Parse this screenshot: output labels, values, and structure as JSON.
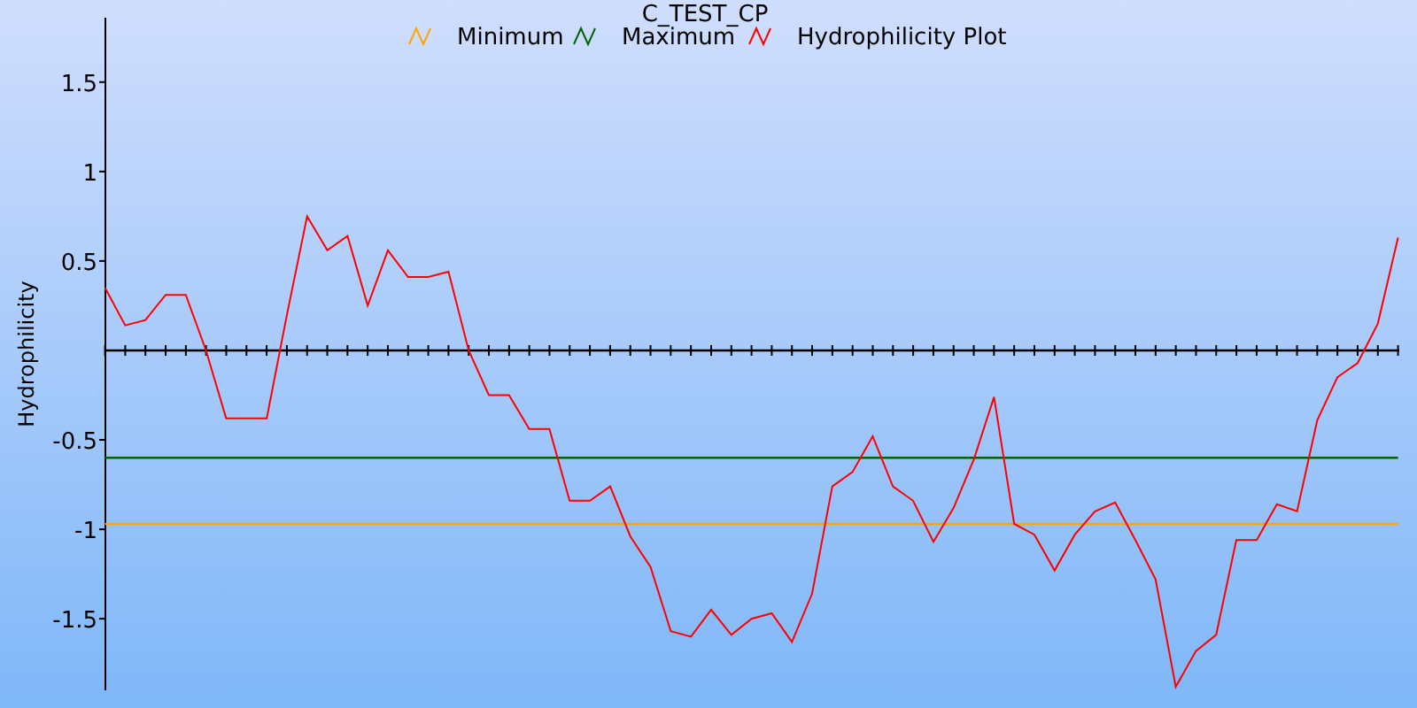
{
  "chart": {
    "chart_data": {
      "type": "line",
      "title": "C_TEST_CP",
      "ylabel": "Hydrophilicity",
      "legend": "top",
      "ylim": [
        -1.9,
        1.86
      ],
      "yticks": [
        1.5,
        1,
        0.5,
        -0.5,
        -1,
        -1.5
      ],
      "series": [
        {
          "name": "Minimum",
          "color": "#ffa500",
          "values": [
            -0.97,
            -0.97,
            -0.97,
            -0.97,
            -0.97,
            -0.97,
            -0.97,
            -0.97,
            -0.97,
            -0.97,
            -0.97,
            -0.97,
            -0.97,
            -0.97,
            -0.97,
            -0.97,
            -0.97,
            -0.97,
            -0.97,
            -0.97,
            -0.97,
            -0.97,
            -0.97,
            -0.97,
            -0.97,
            -0.97,
            -0.97,
            -0.97,
            -0.97,
            -0.97,
            -0.97,
            -0.97,
            -0.97,
            -0.97,
            -0.97,
            -0.97,
            -0.97,
            -0.97,
            -0.97,
            -0.97,
            -0.97,
            -0.97,
            -0.97,
            -0.97,
            -0.97,
            -0.97,
            -0.97,
            -0.97,
            -0.97,
            -0.97,
            -0.97,
            -0.97,
            -0.97,
            -0.97,
            -0.97,
            -0.97,
            -0.97,
            -0.97,
            -0.97,
            -0.97,
            -0.97,
            -0.97,
            -0.97,
            -0.97,
            -0.97
          ]
        },
        {
          "name": "Maximum",
          "color": "#006400",
          "values": [
            -0.6,
            -0.6,
            -0.6,
            -0.6,
            -0.6,
            -0.6,
            -0.6,
            -0.6,
            -0.6,
            -0.6,
            -0.6,
            -0.6,
            -0.6,
            -0.6,
            -0.6,
            -0.6,
            -0.6,
            -0.6,
            -0.6,
            -0.6,
            -0.6,
            -0.6,
            -0.6,
            -0.6,
            -0.6,
            -0.6,
            -0.6,
            -0.6,
            -0.6,
            -0.6,
            -0.6,
            -0.6,
            -0.6,
            -0.6,
            -0.6,
            -0.6,
            -0.6,
            -0.6,
            -0.6,
            -0.6,
            -0.6,
            -0.6,
            -0.6,
            -0.6,
            -0.6,
            -0.6,
            -0.6,
            -0.6,
            -0.6,
            -0.6,
            -0.6,
            -0.6,
            -0.6,
            -0.6,
            -0.6,
            -0.6,
            -0.6,
            -0.6,
            -0.6,
            -0.6,
            -0.6,
            -0.6,
            -0.6,
            -0.6,
            -0.6
          ]
        },
        {
          "name": "Hydrophilicity Plot",
          "color": "#ff0000",
          "values": [
            0.35,
            0.14,
            0.17,
            0.31,
            0.31,
            0.0,
            -0.38,
            -0.38,
            -0.38,
            0.2,
            0.75,
            0.56,
            0.64,
            0.25,
            0.56,
            0.41,
            0.41,
            0.44,
            0.0,
            -0.25,
            -0.25,
            -0.44,
            -0.44,
            -0.84,
            -0.84,
            -0.76,
            -1.04,
            -1.21,
            -1.57,
            -1.6,
            -1.45,
            -1.59,
            -1.5,
            -1.47,
            -1.63,
            -1.36,
            -0.76,
            -0.68,
            -0.48,
            -0.76,
            -0.84,
            -1.07,
            -0.88,
            -0.61,
            -0.26,
            -0.97,
            -1.03,
            -1.23,
            -1.03,
            -0.9,
            -0.85,
            -1.06,
            -1.28,
            -1.88,
            -1.68,
            -1.59,
            -1.06,
            -1.06,
            -0.86,
            -0.9,
            -0.39,
            -0.15,
            -0.07,
            0.15,
            0.63
          ]
        }
      ]
    }
  }
}
